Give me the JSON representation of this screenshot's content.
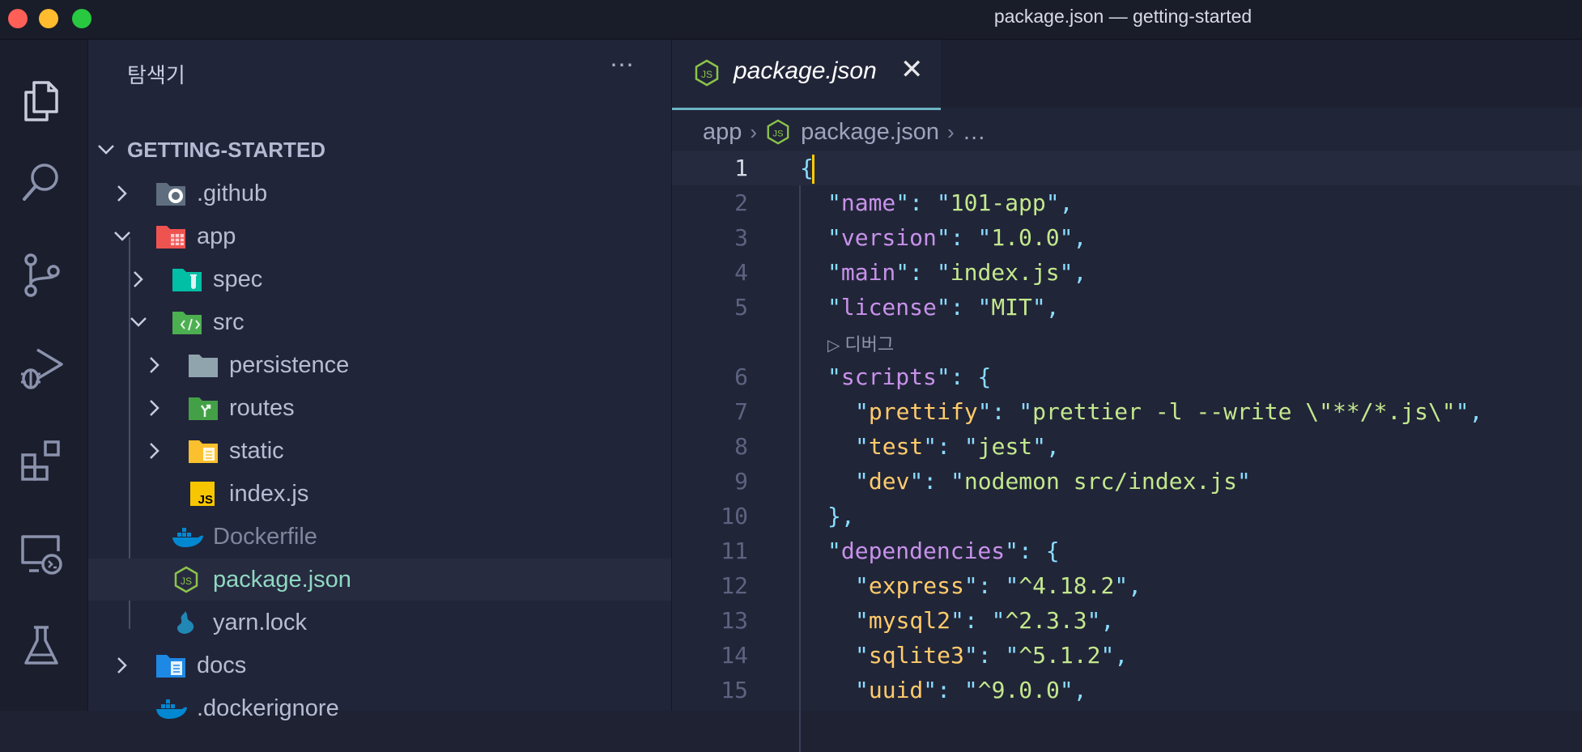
{
  "window": {
    "title": "package.json — getting-started"
  },
  "activity_bar": {
    "items": [
      {
        "name": "explorer-icon"
      },
      {
        "name": "search-icon"
      },
      {
        "name": "source-control-icon"
      },
      {
        "name": "run-debug-icon"
      },
      {
        "name": "extensions-icon"
      },
      {
        "name": "remote-explorer-icon"
      },
      {
        "name": "testing-icon"
      }
    ]
  },
  "sidebar": {
    "title": "탐색기",
    "more": "⋯",
    "project": "GETTING-STARTED",
    "tree": [
      {
        "label": ".github",
        "icon": "github-folder-icon"
      },
      {
        "label": "app",
        "icon": "app-folder-icon"
      },
      {
        "label": "spec",
        "icon": "test-folder-icon"
      },
      {
        "label": "src",
        "icon": "src-folder-icon"
      },
      {
        "label": "persistence",
        "icon": "folder-icon"
      },
      {
        "label": "routes",
        "icon": "routes-folder-icon"
      },
      {
        "label": "static",
        "icon": "static-folder-icon"
      },
      {
        "label": "index.js",
        "icon": "js-file-icon"
      },
      {
        "label": "Dockerfile",
        "icon": "docker-icon"
      },
      {
        "label": "package.json",
        "icon": "nodejs-icon"
      },
      {
        "label": "yarn.lock",
        "icon": "yarn-icon"
      },
      {
        "label": "docs",
        "icon": "docs-folder-icon"
      },
      {
        "label": ".dockerignore",
        "icon": "docker-icon"
      }
    ]
  },
  "editor": {
    "tab": {
      "label": "package.json",
      "close": "✕"
    },
    "breadcrumb": {
      "folder": "app",
      "file": "package.json",
      "ellipsis": "…"
    },
    "codelens": "디버그",
    "lines": [
      {
        "n": "1"
      },
      {
        "n": "2"
      },
      {
        "n": "3"
      },
      {
        "n": "4"
      },
      {
        "n": "5"
      },
      {
        "n": "6"
      },
      {
        "n": "7"
      },
      {
        "n": "8"
      },
      {
        "n": "9"
      },
      {
        "n": "10"
      },
      {
        "n": "11"
      },
      {
        "n": "12"
      },
      {
        "n": "13"
      },
      {
        "n": "14"
      },
      {
        "n": "15"
      }
    ],
    "json": {
      "name_key": "name",
      "name_val": "101-app",
      "version_key": "version",
      "version_val": "1.0.0",
      "main_key": "main",
      "main_val": "index.js",
      "license_key": "license",
      "license_val": "MIT",
      "scripts_key": "scripts",
      "prettify_key": "prettify",
      "prettify_val": "prettier -l --write \\\"**/*.js\\\"",
      "test_key": "test",
      "test_val": "jest",
      "dev_key": "dev",
      "dev_val": "nodemon src/index.js",
      "dependencies_key": "dependencies",
      "express_key": "express",
      "express_val": "^4.18.2",
      "mysql2_key": "mysql2",
      "mysql2_val": "^2.3.3",
      "sqlite3_key": "sqlite3",
      "sqlite3_val": "^5.1.2",
      "uuid_key": "uuid",
      "uuid_val": "^9.0.0"
    }
  },
  "colors": {
    "background": "#1e2233",
    "key": "#c792ea",
    "string": "#c3e88d",
    "punctuation": "#89ddff",
    "tab_accent": "#6bb4c4"
  }
}
